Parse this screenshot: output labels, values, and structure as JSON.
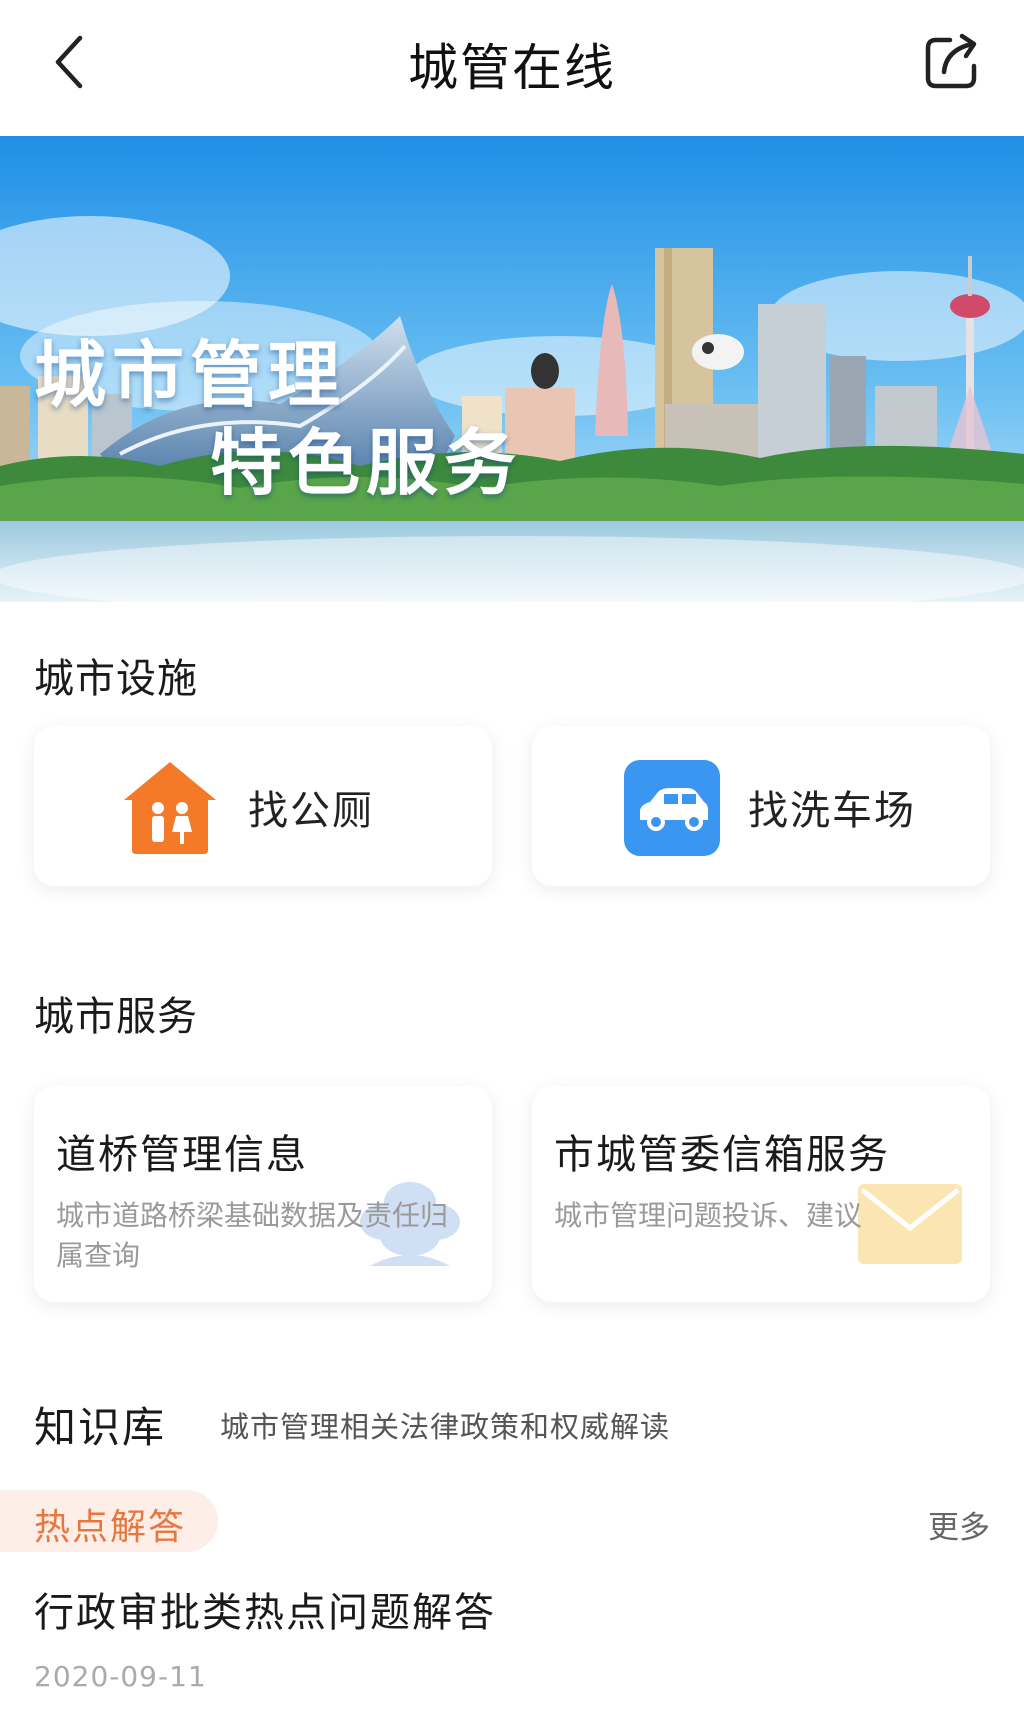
{
  "header": {
    "title": "城管在线",
    "back_icon": "chevron-left-icon",
    "share_icon": "share-icon"
  },
  "banner": {
    "line1": "城市管理",
    "line2": "特色服务"
  },
  "facilities": {
    "title": "城市设施",
    "items": [
      {
        "label": "找公厕",
        "icon": "restroom-icon",
        "color": "#f47a2a"
      },
      {
        "label": "找洗车场",
        "icon": "car-icon",
        "color": "#3a96f0"
      }
    ]
  },
  "services": {
    "title": "城市服务",
    "items": [
      {
        "title": "道桥管理信息",
        "desc": "城市道路桥梁基础数据及责任归属查询",
        "icon": "flower-icon"
      },
      {
        "title": "市城管委信箱服务",
        "desc": "城市管理问题投诉、建议",
        "icon": "envelope-icon"
      }
    ]
  },
  "knowledge": {
    "title": "知识库",
    "subtitle": "城市管理相关法律政策和权威解读",
    "tag": "热点解答",
    "more": "更多",
    "article": {
      "title": "行政审批类热点问题解答",
      "date": "2020-09-11"
    }
  },
  "colors": {
    "accent_orange": "#e8773e",
    "tag_bg": "#fdeee8",
    "sky_blue": "#2f9be8"
  }
}
